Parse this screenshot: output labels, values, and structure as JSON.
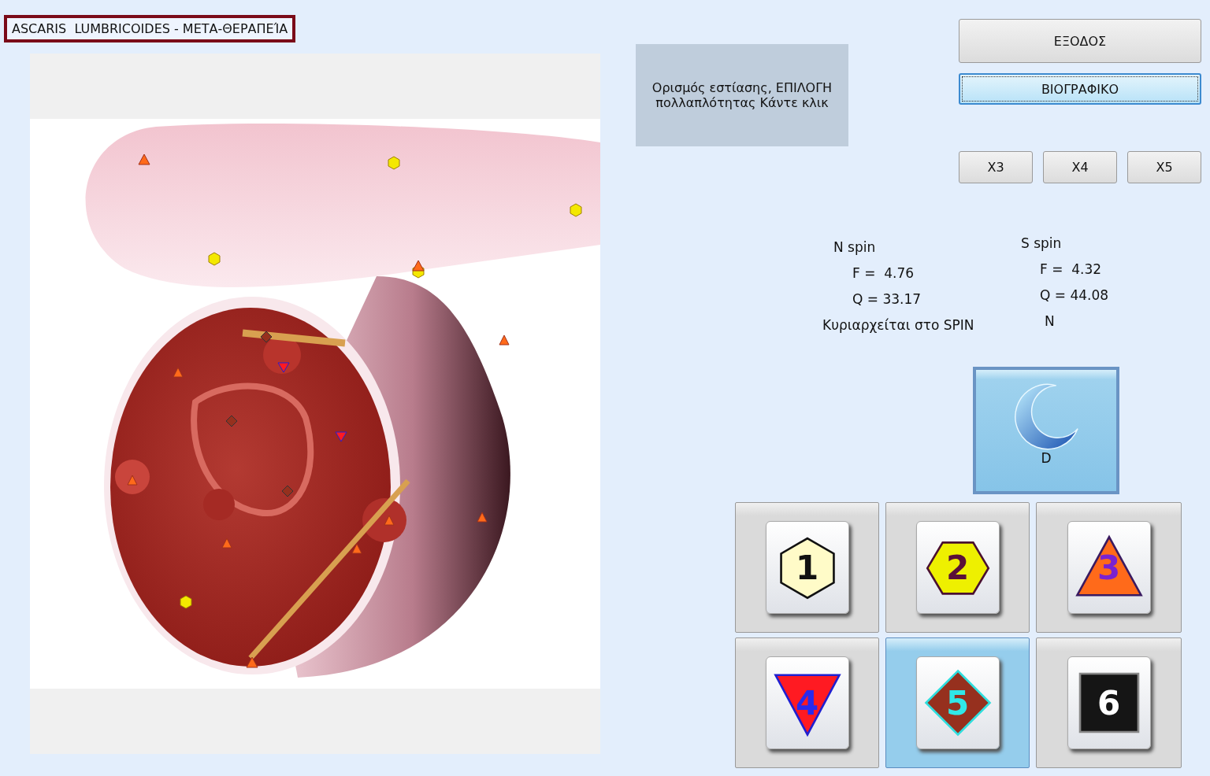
{
  "title": "ASCARIS  LUMBRICOIDES - ΜΕΤΑ-ΘΕΡΑΠΕΊΑ",
  "info_box": "Ορισμός εστίασης, ΕΠΙΛΟΓΗ πολλαπλότητας Κάντε κλικ",
  "exit_button": "ΕΞΟΔΟΣ",
  "bio_button": {
    "label": "ΒΙΟΓΡΑΦΙΚΟ",
    "focused": true
  },
  "zoom_buttons": [
    {
      "label": "X3"
    },
    {
      "label": "X4"
    },
    {
      "label": "X5"
    }
  ],
  "spin": {
    "n": {
      "title": "N spin",
      "f": "F =  4.76",
      "q": "Q = 33.17"
    },
    "s": {
      "title": "S spin",
      "f": "F =  4.32",
      "q": "Q = 44.08"
    },
    "dominant_label": "Κυριαρχείται στο SPIN",
    "dominant_value": "N"
  },
  "mode_button": {
    "label": "D",
    "selected": true
  },
  "shape_buttons": [
    {
      "label": "1",
      "kind": "hexagon",
      "color": "#fffbc8",
      "selected": false
    },
    {
      "label": "2",
      "kind": "hexagon-flat",
      "color": "#eef000",
      "selected": false
    },
    {
      "label": "3",
      "kind": "triangle",
      "color": "#ff6a1a",
      "selected": false
    },
    {
      "label": "4",
      "kind": "triangle-down",
      "color": "#ff1a22",
      "selected": false
    },
    {
      "label": "5",
      "kind": "diamond",
      "color": "#96301e",
      "selected": true
    },
    {
      "label": "6",
      "kind": "square",
      "color": "#151515",
      "selected": false
    }
  ]
}
